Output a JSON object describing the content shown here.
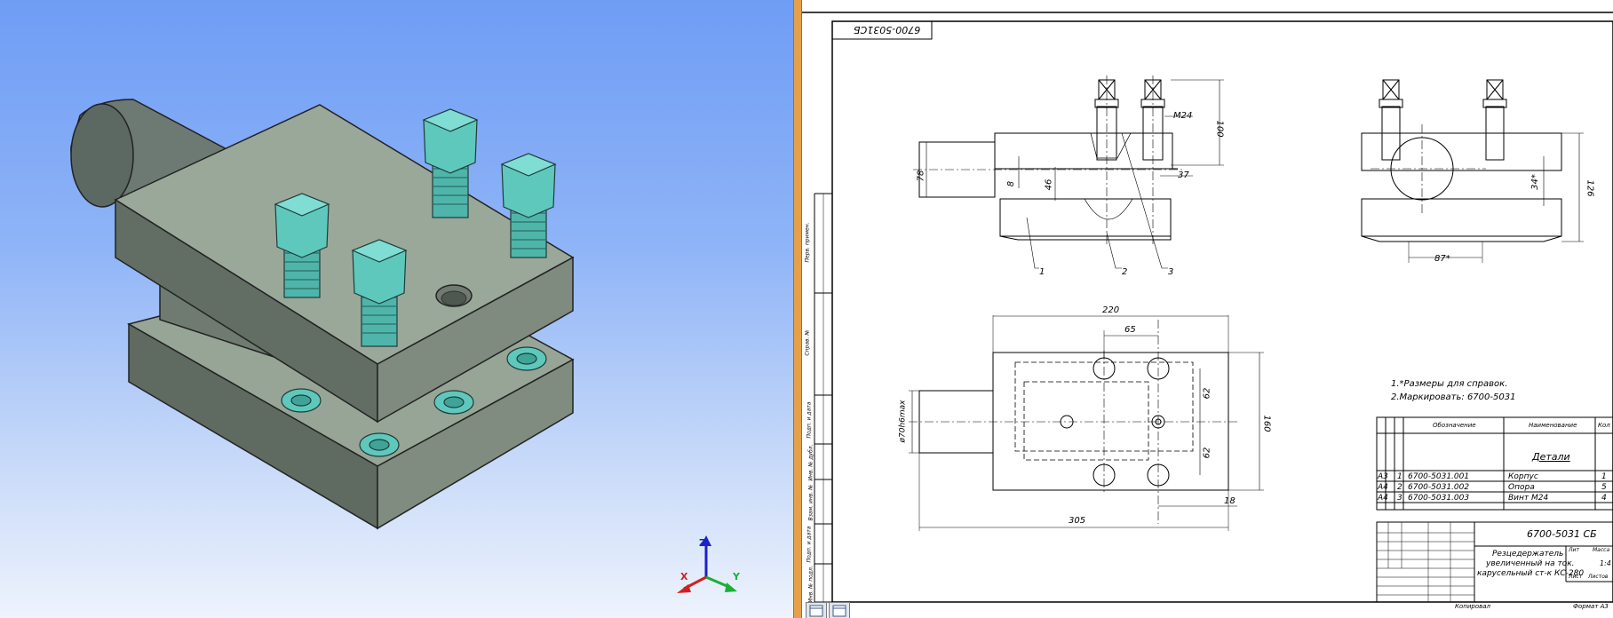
{
  "viewport": {
    "axes": {
      "x": "X",
      "y": "Y",
      "z": "Z"
    },
    "colors": {
      "body": "#8a9a8a",
      "bolt": "#5fc8bd",
      "bg_top": "#6f9df5",
      "bg_bottom": "#eef3fd"
    }
  },
  "drawing": {
    "stamp_code": "6700-5031СБ",
    "dims": {
      "d100": "100",
      "m24": "М24",
      "d78": "78",
      "d8": "8",
      "d46": "46",
      "d37": "37",
      "d126": "126",
      "d34": "34*",
      "d87": "87*",
      "d220": "220",
      "d65": "65",
      "d62a": "62",
      "d62b": "62",
      "d160": "160",
      "d305": "305",
      "d18": "18",
      "d70": "ø70h6max",
      "lead1": "1",
      "lead2": "2",
      "lead3": "3"
    },
    "notes": [
      "1.*Размеры для справок.",
      "2.Маркировать: 6700-5031"
    ],
    "spec": {
      "header_designation": "Обозначение",
      "header_name": "Наименование",
      "header_qty": "Кол",
      "section": "Детали",
      "rows": [
        {
          "format": "А3",
          "pos": "1",
          "designation": "6700-5031.001",
          "name": "Корпус",
          "qty": "1"
        },
        {
          "format": "А4",
          "pos": "2",
          "designation": "6700-5031.002",
          "name": "Опора",
          "qty": "5"
        },
        {
          "format": "А4",
          "pos": "3",
          "designation": "6700-5031.003",
          "name": "Винт М24",
          "qty": "4"
        }
      ]
    },
    "title_block": {
      "code": "6700-5031 СБ",
      "title_lines": [
        "Резцедержатель",
        "увеличенный на ток.",
        "карусельный ст-к КС-280"
      ],
      "scale": "1:4",
      "lit": "Лит",
      "mass": "Масса",
      "sheet": "Лист",
      "sheets": "Листов",
      "copied": "Копировал",
      "format": "Формат А3"
    },
    "stamp_left": [
      "Перв. примен.",
      "Справ. №",
      "Подп. и дата",
      "Инв. № дубл.",
      "Взам. инв. №",
      "Подп. и дата",
      "Инв. № подл."
    ]
  }
}
